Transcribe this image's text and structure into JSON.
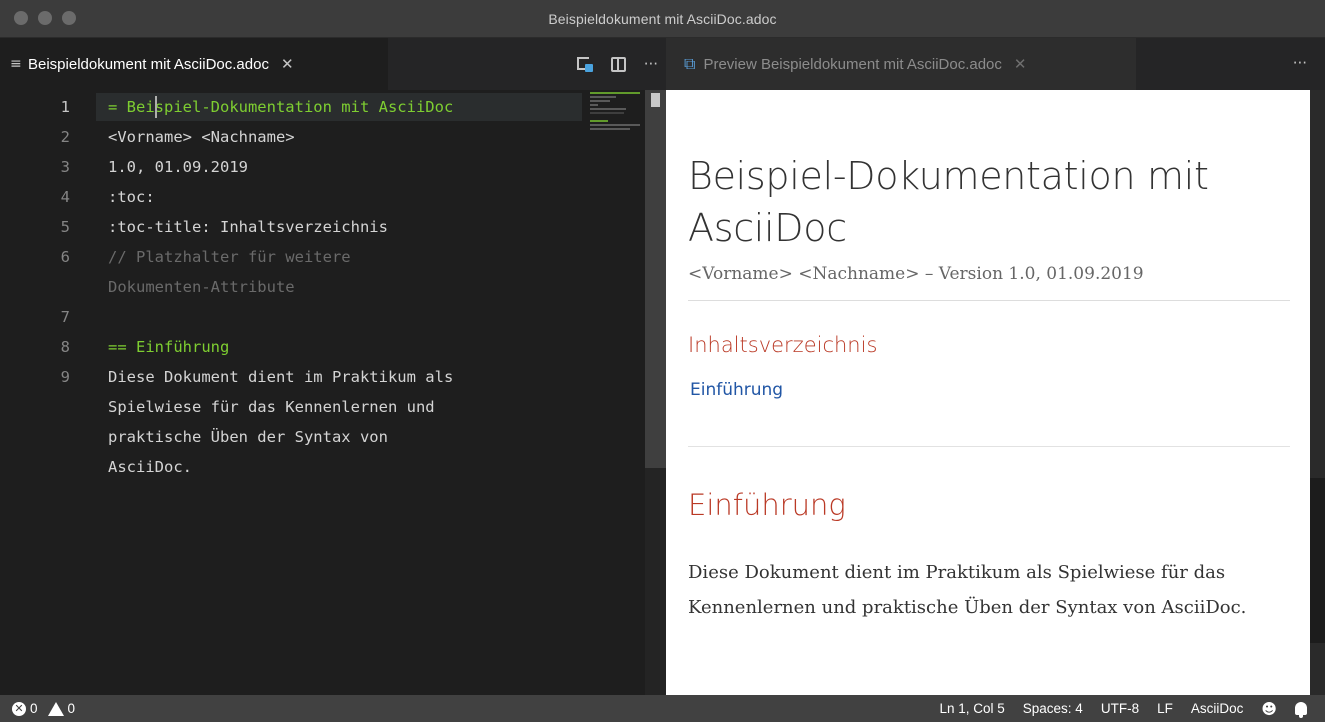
{
  "window": {
    "title": "Beispieldokument mit AsciiDoc.adoc"
  },
  "editor": {
    "tab": {
      "label": "Beispieldokument mit AsciiDoc.adoc",
      "icon": "lines-icon",
      "close": "✕"
    },
    "actions": {
      "more": "···"
    },
    "lines": [
      {
        "num": "1",
        "text": "= Beispiel-Dokumentation mit AsciiDoc",
        "style": "heading"
      },
      {
        "num": "2",
        "text": "<Vorname> <Nachname>",
        "style": "plain"
      },
      {
        "num": "3",
        "text": "1.0, 01.09.2019",
        "style": "plain"
      },
      {
        "num": "4",
        "text": ":toc:",
        "style": "plain"
      },
      {
        "num": "5",
        "text": ":toc-title: Inhaltsverzeichnis",
        "style": "plain"
      },
      {
        "num": "6",
        "text": "// Platzhalter für weitere",
        "style": "comment"
      },
      {
        "num": "",
        "text": "Dokumenten-Attribute",
        "style": "comment"
      },
      {
        "num": "7",
        "text": "",
        "style": "plain"
      },
      {
        "num": "8",
        "text": "== Einführung",
        "style": "heading"
      },
      {
        "num": "9",
        "text": "Diese Dokument dient im Praktikum als",
        "style": "plain"
      },
      {
        "num": "",
        "text": "Spielwiese für das Kennenlernen und",
        "style": "plain"
      },
      {
        "num": "",
        "text": "praktische Üben der Syntax von",
        "style": "plain"
      },
      {
        "num": "",
        "text": "AsciiDoc.",
        "style": "plain"
      }
    ]
  },
  "preview": {
    "tab": {
      "label": "Preview Beispieldokument mit AsciiDoc.adoc",
      "close": "✕"
    },
    "more": "···",
    "doc_title": "Beispiel-Dokumentation mit AsciiDoc",
    "details": "<Vorname> <Nachname> – Version 1.0, 01.09.2019",
    "toc_title": "Inhaltsverzeichnis",
    "toc_link": "Einführung",
    "section_title": "Einführung",
    "section_text": "Diese Dokument dient im Praktikum als Spielwiese für das Kennenlernen und praktische Üben der Syntax von AsciiDoc."
  },
  "status": {
    "errors": "0",
    "warnings": "0",
    "position": "Ln 1, Col 5",
    "spaces": "Spaces: 4",
    "encoding": "UTF-8",
    "eol": "LF",
    "language": "AsciiDoc"
  },
  "colors": {
    "heading": "#7ece31",
    "section_red": "#ba3925",
    "link_blue": "#2156a5"
  }
}
